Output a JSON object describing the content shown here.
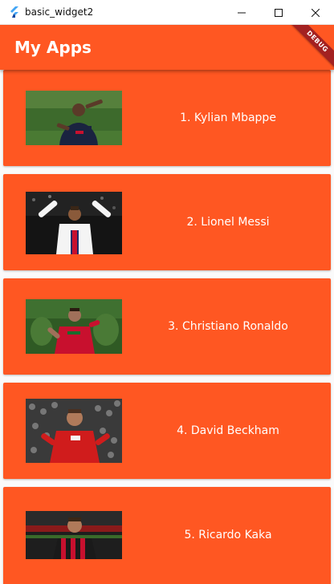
{
  "window": {
    "title": "basic_widget2",
    "app_icon": "flutter-icon",
    "controls": [
      "minimize-icon",
      "maximize-icon",
      "close-icon"
    ]
  },
  "appbar": {
    "title": "My Apps",
    "color": "#ff5722"
  },
  "debug_banner": {
    "label": "DEBUG",
    "color": "#a32121"
  },
  "players": [
    {
      "label": "1. Kylian Mbappe",
      "image": "kylian-mbappe-photo"
    },
    {
      "label": "2. Lionel Messi",
      "image": "lionel-messi-photo"
    },
    {
      "label": "3. Christiano Ronaldo",
      "image": "christiano-ronaldo-photo"
    },
    {
      "label": "4. David Beckham",
      "image": "david-beckham-photo"
    },
    {
      "label": "5. Ricardo Kaka",
      "image": "ricardo-kaka-photo"
    }
  ]
}
